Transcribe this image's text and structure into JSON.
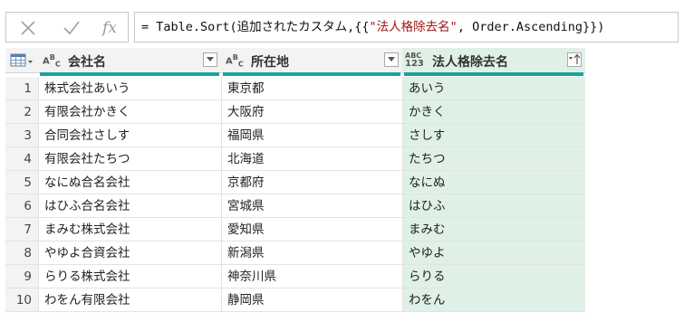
{
  "formula_bar": {
    "cancel_icon": "close-icon",
    "confirm_icon": "check-icon",
    "fx_label": "fx",
    "formula_prefix": "= Table.Sort(追加されたカスタム,{{",
    "formula_string": "\"法人格除去名\"",
    "formula_suffix": ", Order.Ascending}})"
  },
  "grid": {
    "columns": [
      {
        "type": "ABC",
        "name": "会社名"
      },
      {
        "type": "ABC",
        "name": "所在地"
      },
      {
        "type": "ABC123",
        "name": "法人格除去名"
      }
    ],
    "type_labels": {
      "text": "A",
      "text_sup": "B",
      "text_sub": "C",
      "any_top": "ABC",
      "any_bottom": "123"
    },
    "rows": [
      {
        "n": "1",
        "c1": "株式会社あいう",
        "c2": "東京都",
        "c3": "あいう"
      },
      {
        "n": "2",
        "c1": "有限会社かきく",
        "c2": "大阪府",
        "c3": "かきく"
      },
      {
        "n": "3",
        "c1": "合同会社さしす",
        "c2": "福岡県",
        "c3": "さしす"
      },
      {
        "n": "4",
        "c1": "有限会社たちつ",
        "c2": "北海道",
        "c3": "たちつ"
      },
      {
        "n": "5",
        "c1": "なにぬ合名会社",
        "c2": "京都府",
        "c3": "なにぬ"
      },
      {
        "n": "6",
        "c1": "はひふ合名会社",
        "c2": "宮城県",
        "c3": "はひふ"
      },
      {
        "n": "7",
        "c1": "まみむ株式会社",
        "c2": "愛知県",
        "c3": "まみむ"
      },
      {
        "n": "8",
        "c1": "やゆよ合資会社",
        "c2": "新潟県",
        "c3": "やゆよ"
      },
      {
        "n": "9",
        "c1": "らりる株式会社",
        "c2": "神奈川県",
        "c3": "らりる"
      },
      {
        "n": "10",
        "c1": "わをん有限会社",
        "c2": "静岡県",
        "c3": "わをん"
      }
    ]
  },
  "colors": {
    "quality_bar": "#1ba39c",
    "selected_column": "#dff1e6"
  }
}
